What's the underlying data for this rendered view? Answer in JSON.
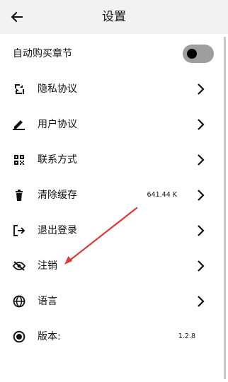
{
  "header": {
    "title": "设置",
    "back_icon": "arrow-left-icon"
  },
  "settings": {
    "auto_buy": {
      "label": "自动购买章节",
      "enabled": false
    },
    "items": [
      {
        "label": "隐私协议",
        "icon": "privacy-icon"
      },
      {
        "label": "用户协议",
        "icon": "pen-icon"
      },
      {
        "label": "联系方式",
        "icon": "qr-code-icon"
      },
      {
        "label": "清除缓存",
        "icon": "trash-icon",
        "value": "641.44 K"
      },
      {
        "label": "退出登录",
        "icon": "logout-icon"
      },
      {
        "label": "注销",
        "icon": "eye-off-icon"
      },
      {
        "label": "语言",
        "icon": "globe-icon"
      },
      {
        "label": "版本:",
        "icon": "record-icon",
        "value": "1.2.8"
      }
    ]
  },
  "colors": {
    "annotation_arrow": "#e03b3b",
    "toggle_track": "#9e9e9e",
    "header_background": "#f2f2f2"
  }
}
